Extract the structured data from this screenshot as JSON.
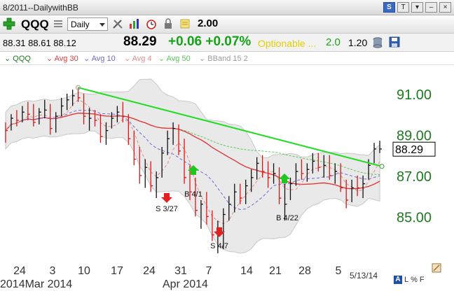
{
  "window": {
    "title": "8/2011--DailywithBB",
    "buttons": [
      "S",
      "T",
      "▾",
      "–",
      "×"
    ]
  },
  "toolbar": {
    "symbol": "QQQ",
    "period": "Daily",
    "value": "2.00"
  },
  "quote": {
    "ohl": "88.31 88.61 88.12",
    "last": "88.29",
    "change": "+0.06 +0.07%",
    "optionable": "Optionable ...",
    "version": "2.0",
    "extra": "1.20"
  },
  "legend": [
    {
      "label": "QQQ",
      "color": "#1a7f1a"
    },
    {
      "label": "Avg 30",
      "color": "#e03a3a"
    },
    {
      "label": "Avg 10",
      "color": "#6b6bd8"
    },
    {
      "label": "Avg 4",
      "color": "#e88a8a"
    },
    {
      "label": "Avg 50",
      "color": "#5bc85b"
    },
    {
      "label": "BBand 15 2",
      "color": "#9c9c9c"
    }
  ],
  "chart_data": {
    "type": "bar",
    "y_range": [
      83,
      92.4
    ],
    "y_ticks": [
      {
        "label": "91.00",
        "value": 91
      },
      {
        "label": "89.00",
        "value": 89
      },
      {
        "label": "87.00",
        "value": 87
      },
      {
        "label": "85.00",
        "value": 85
      }
    ],
    "last_label": "88.29",
    "x_ticks": [
      "24",
      "3",
      "10",
      "17",
      "24",
      "31",
      "7",
      "14",
      "21",
      "28",
      "5"
    ],
    "x_month_labels": [
      "2014Mar 2014",
      "Apr 2014"
    ],
    "date_stamp": "5/13/14",
    "annotations": [
      {
        "text": "S 3/27",
        "arrow": "down",
        "color": "#e32020"
      },
      {
        "text": "B 4/1",
        "arrow": "up",
        "color": "#1ec81e"
      },
      {
        "text": "S 4/7",
        "arrow": "down",
        "color": "#e32020"
      },
      {
        "text": "B 4/22",
        "arrow": "up",
        "color": "#1ec81e"
      }
    ],
    "bars": [
      {
        "h": 89.6,
        "l": 88.6,
        "c": 89.2,
        "color": "red"
      },
      {
        "h": 90.0,
        "l": 89.2,
        "c": 89.8,
        "color": "black"
      },
      {
        "h": 90.2,
        "l": 89.4,
        "c": 89.7,
        "color": "red"
      },
      {
        "h": 90.4,
        "l": 89.6,
        "c": 90.1,
        "color": "black"
      },
      {
        "h": 90.6,
        "l": 89.7,
        "c": 90.0,
        "color": "red"
      },
      {
        "h": 90.5,
        "l": 89.4,
        "c": 89.6,
        "color": "red"
      },
      {
        "h": 90.3,
        "l": 89.5,
        "c": 90.1,
        "color": "black"
      },
      {
        "h": 90.7,
        "l": 89.8,
        "c": 90.2,
        "color": "black"
      },
      {
        "h": 90.5,
        "l": 89.0,
        "c": 89.3,
        "color": "red"
      },
      {
        "h": 90.1,
        "l": 89.1,
        "c": 89.9,
        "color": "black"
      },
      {
        "h": 90.8,
        "l": 89.9,
        "c": 90.4,
        "color": "black"
      },
      {
        "h": 91.0,
        "l": 90.2,
        "c": 90.7,
        "color": "black"
      },
      {
        "h": 91.2,
        "l": 90.4,
        "c": 90.9,
        "color": "black"
      },
      {
        "h": 91.3,
        "l": 90.6,
        "c": 90.8,
        "color": "red"
      },
      {
        "h": 91.0,
        "l": 89.5,
        "c": 89.9,
        "color": "red"
      },
      {
        "h": 90.3,
        "l": 89.2,
        "c": 89.8,
        "color": "black"
      },
      {
        "h": 90.2,
        "l": 89.4,
        "c": 89.7,
        "color": "red"
      },
      {
        "h": 90.0,
        "l": 88.6,
        "c": 88.9,
        "color": "red"
      },
      {
        "h": 89.6,
        "l": 88.5,
        "c": 89.2,
        "color": "black"
      },
      {
        "h": 90.1,
        "l": 89.3,
        "c": 89.8,
        "color": "black"
      },
      {
        "h": 90.4,
        "l": 89.6,
        "c": 90.1,
        "color": "black"
      },
      {
        "h": 90.6,
        "l": 89.6,
        "c": 89.9,
        "color": "red"
      },
      {
        "h": 90.0,
        "l": 88.5,
        "c": 88.8,
        "color": "red"
      },
      {
        "h": 89.2,
        "l": 87.5,
        "c": 87.8,
        "color": "red"
      },
      {
        "h": 88.4,
        "l": 86.6,
        "c": 87.0,
        "color": "red"
      },
      {
        "h": 87.8,
        "l": 86.4,
        "c": 87.4,
        "color": "black"
      },
      {
        "h": 87.7,
        "l": 86.2,
        "c": 86.5,
        "color": "red"
      },
      {
        "h": 87.2,
        "l": 85.9,
        "c": 86.9,
        "color": "black"
      },
      {
        "h": 88.4,
        "l": 86.9,
        "c": 88.1,
        "color": "black"
      },
      {
        "h": 89.2,
        "l": 88.0,
        "c": 88.8,
        "color": "black"
      },
      {
        "h": 89.6,
        "l": 88.5,
        "c": 89.3,
        "color": "black"
      },
      {
        "h": 89.5,
        "l": 88.0,
        "c": 88.2,
        "color": "red"
      },
      {
        "h": 88.8,
        "l": 86.6,
        "c": 86.9,
        "color": "red"
      },
      {
        "h": 87.5,
        "l": 85.8,
        "c": 86.2,
        "color": "red"
      },
      {
        "h": 86.9,
        "l": 85.0,
        "c": 85.3,
        "color": "red"
      },
      {
        "h": 85.8,
        "l": 84.4,
        "c": 85.6,
        "color": "black"
      },
      {
        "h": 86.2,
        "l": 84.6,
        "c": 85.0,
        "color": "red"
      },
      {
        "h": 85.3,
        "l": 83.8,
        "c": 84.1,
        "color": "red"
      },
      {
        "h": 84.8,
        "l": 83.2,
        "c": 84.4,
        "color": "black"
      },
      {
        "h": 85.4,
        "l": 83.4,
        "c": 85.1,
        "color": "black"
      },
      {
        "h": 86.0,
        "l": 84.8,
        "c": 85.6,
        "color": "black"
      },
      {
        "h": 86.6,
        "l": 85.2,
        "c": 86.2,
        "color": "black"
      },
      {
        "h": 86.6,
        "l": 85.6,
        "c": 85.9,
        "color": "red"
      },
      {
        "h": 86.8,
        "l": 85.6,
        "c": 86.5,
        "color": "black"
      },
      {
        "h": 87.3,
        "l": 86.2,
        "c": 86.9,
        "color": "black"
      },
      {
        "h": 87.9,
        "l": 86.8,
        "c": 87.6,
        "color": "black"
      },
      {
        "h": 88.0,
        "l": 86.9,
        "c": 87.2,
        "color": "red"
      },
      {
        "h": 87.7,
        "l": 86.4,
        "c": 86.9,
        "color": "red"
      },
      {
        "h": 87.6,
        "l": 86.6,
        "c": 87.1,
        "color": "black"
      },
      {
        "h": 87.4,
        "l": 85.6,
        "c": 85.9,
        "color": "red"
      },
      {
        "h": 86.6,
        "l": 84.8,
        "c": 85.6,
        "color": "black"
      },
      {
        "h": 86.9,
        "l": 85.8,
        "c": 86.6,
        "color": "black"
      },
      {
        "h": 87.6,
        "l": 86.5,
        "c": 87.2,
        "color": "black"
      },
      {
        "h": 87.8,
        "l": 86.8,
        "c": 87.1,
        "color": "red"
      },
      {
        "h": 87.6,
        "l": 86.7,
        "c": 87.3,
        "color": "black"
      },
      {
        "h": 88.1,
        "l": 87.1,
        "c": 87.7,
        "color": "black"
      },
      {
        "h": 88.1,
        "l": 87.2,
        "c": 87.4,
        "color": "red"
      },
      {
        "h": 88.0,
        "l": 86.9,
        "c": 87.5,
        "color": "black"
      },
      {
        "h": 88.0,
        "l": 86.8,
        "c": 87.0,
        "color": "red"
      },
      {
        "h": 87.6,
        "l": 86.6,
        "c": 87.2,
        "color": "black"
      },
      {
        "h": 87.6,
        "l": 86.2,
        "c": 86.4,
        "color": "red"
      },
      {
        "h": 86.8,
        "l": 85.4,
        "c": 85.8,
        "color": "red"
      },
      {
        "h": 86.8,
        "l": 85.7,
        "c": 86.4,
        "color": "black"
      },
      {
        "h": 87.0,
        "l": 86.0,
        "c": 86.4,
        "color": "red"
      },
      {
        "h": 87.0,
        "l": 85.9,
        "c": 86.6,
        "color": "black"
      },
      {
        "h": 87.8,
        "l": 86.8,
        "c": 87.5,
        "color": "black"
      },
      {
        "h": 88.6,
        "l": 87.6,
        "c": 88.3,
        "color": "black"
      },
      {
        "h": 88.7,
        "l": 88.1,
        "c": 88.3,
        "color": "black"
      }
    ]
  }
}
